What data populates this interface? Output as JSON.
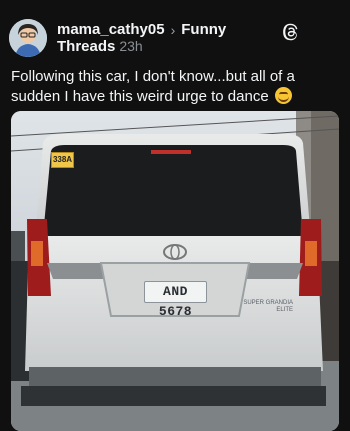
{
  "post": {
    "username": "mama_cathy05",
    "topic_part1": "Funny",
    "topic_part2": "Threads",
    "time": "23h",
    "caption": "Following this car, I don't know...but all of a sudden I have this weird urge to dance"
  },
  "photo": {
    "plate": "AND 5678",
    "sticker": "338A",
    "badge_line1": "SUPER GRANDIA",
    "badge_line2": "ELITE"
  },
  "icons": {
    "separator": "chevron-right-icon",
    "app": "threads-logo-icon",
    "emoji": "rofl-emoji"
  }
}
